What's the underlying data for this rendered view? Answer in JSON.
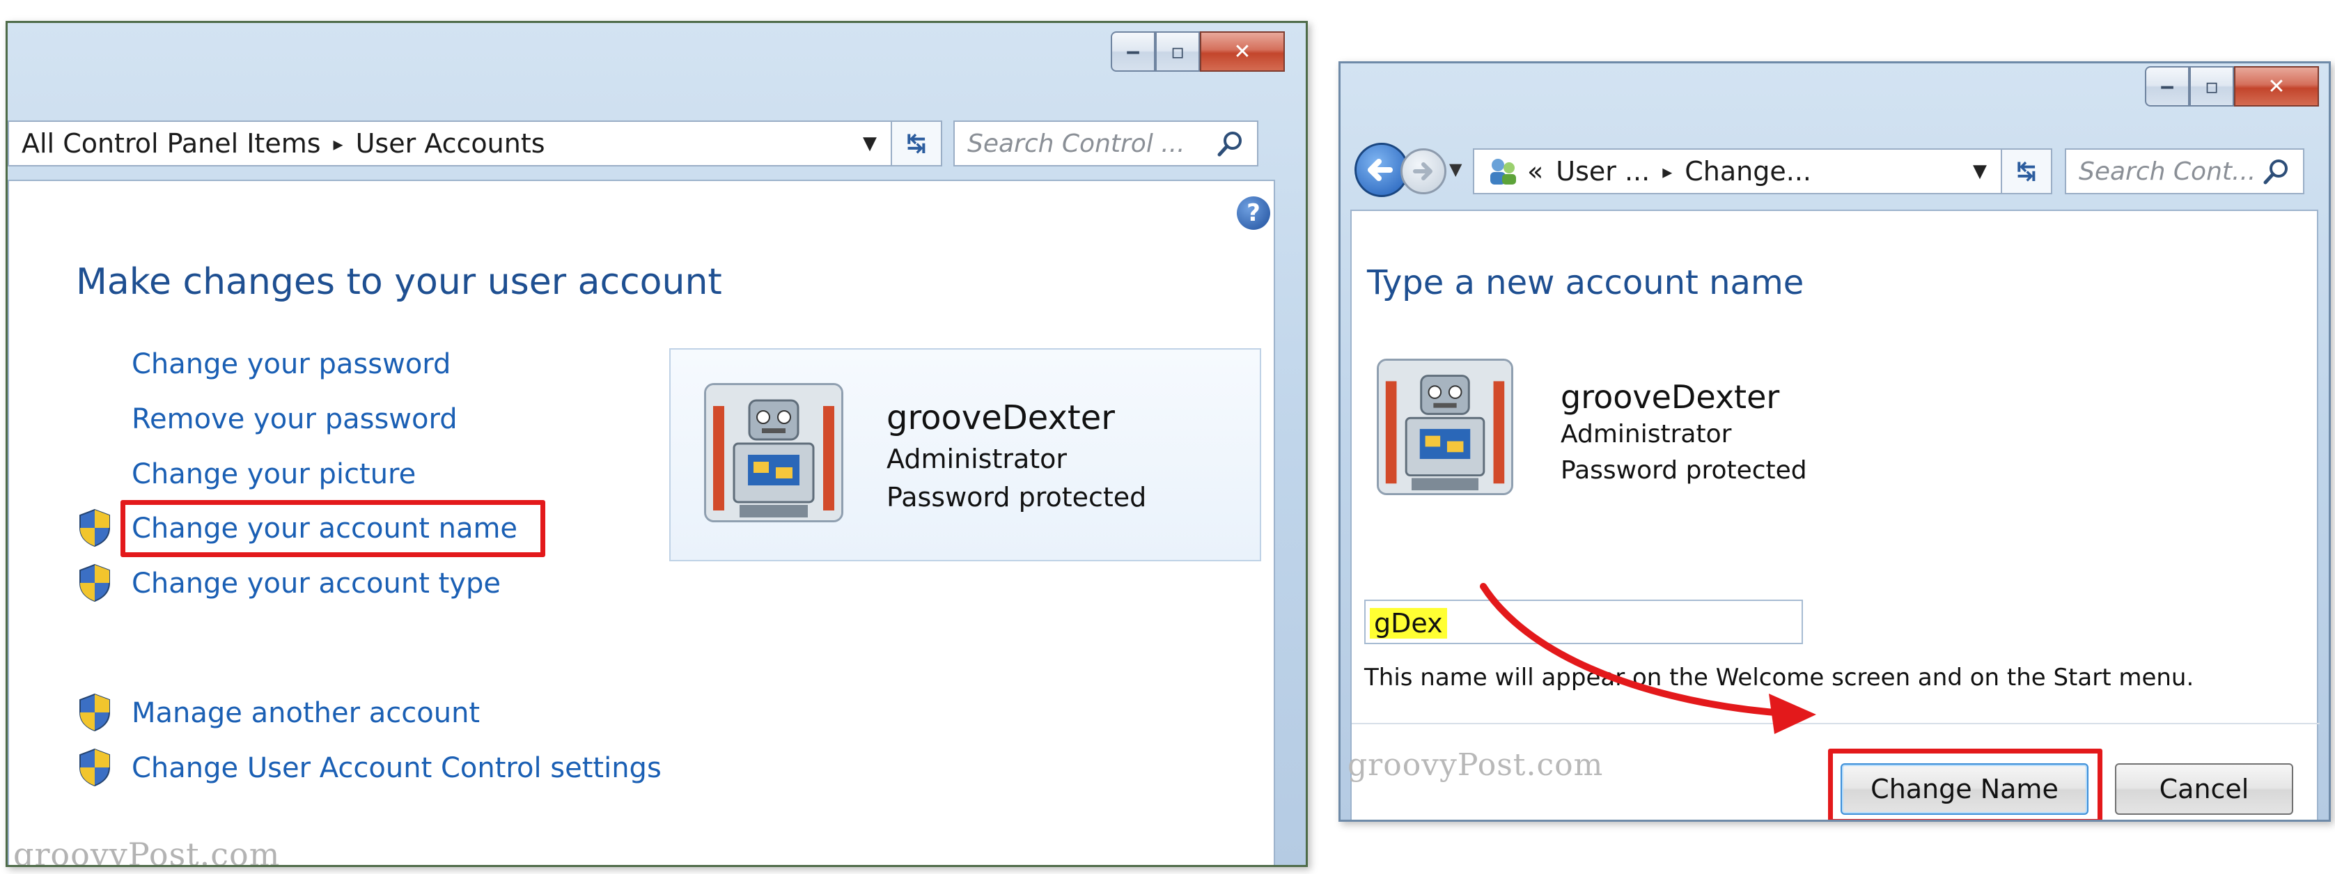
{
  "window1": {
    "breadcrumb": {
      "items": [
        "All Control Panel Items",
        "User Accounts"
      ],
      "separator": "▸"
    },
    "search_placeholder": "Search Control ...",
    "heading": "Make changes to your user account",
    "tasks": [
      "Change your password",
      "Remove your password",
      "Change your picture",
      "Change your account name",
      "Change your account type"
    ],
    "other_tasks": [
      "Manage another account",
      "Change User Account Control settings"
    ],
    "account": {
      "name": "grooveDexter",
      "type": "Administrator",
      "status": "Password protected"
    },
    "watermark": "groovyPost.com"
  },
  "window2": {
    "breadcrumb": {
      "prefix": "«",
      "items": [
        "User ...",
        "Change..."
      ],
      "separator": "▸"
    },
    "search_placeholder": "Search Cont...",
    "heading": "Type a new account name",
    "account": {
      "name": "grooveDexter",
      "type": "Administrator",
      "status": "Password protected"
    },
    "new_name_value": "gDex",
    "note": "This name will appear on the Welcome screen and on the Start menu.",
    "buttons": {
      "change_name": "Change Name",
      "cancel": "Cancel"
    },
    "watermark": "groovyPost.com"
  },
  "colors": {
    "link": "#1a5fb4",
    "heading": "#1e4f91",
    "annotation": "#e3191b",
    "highlight": "#ffff33"
  },
  "icons": [
    "minimize-icon",
    "maximize-icon",
    "close-icon",
    "refresh-icon",
    "search-icon",
    "uac-shield-icon",
    "help-icon",
    "back-arrow-icon",
    "forward-arrow-icon",
    "user-accounts-icon",
    "robot-avatar"
  ]
}
